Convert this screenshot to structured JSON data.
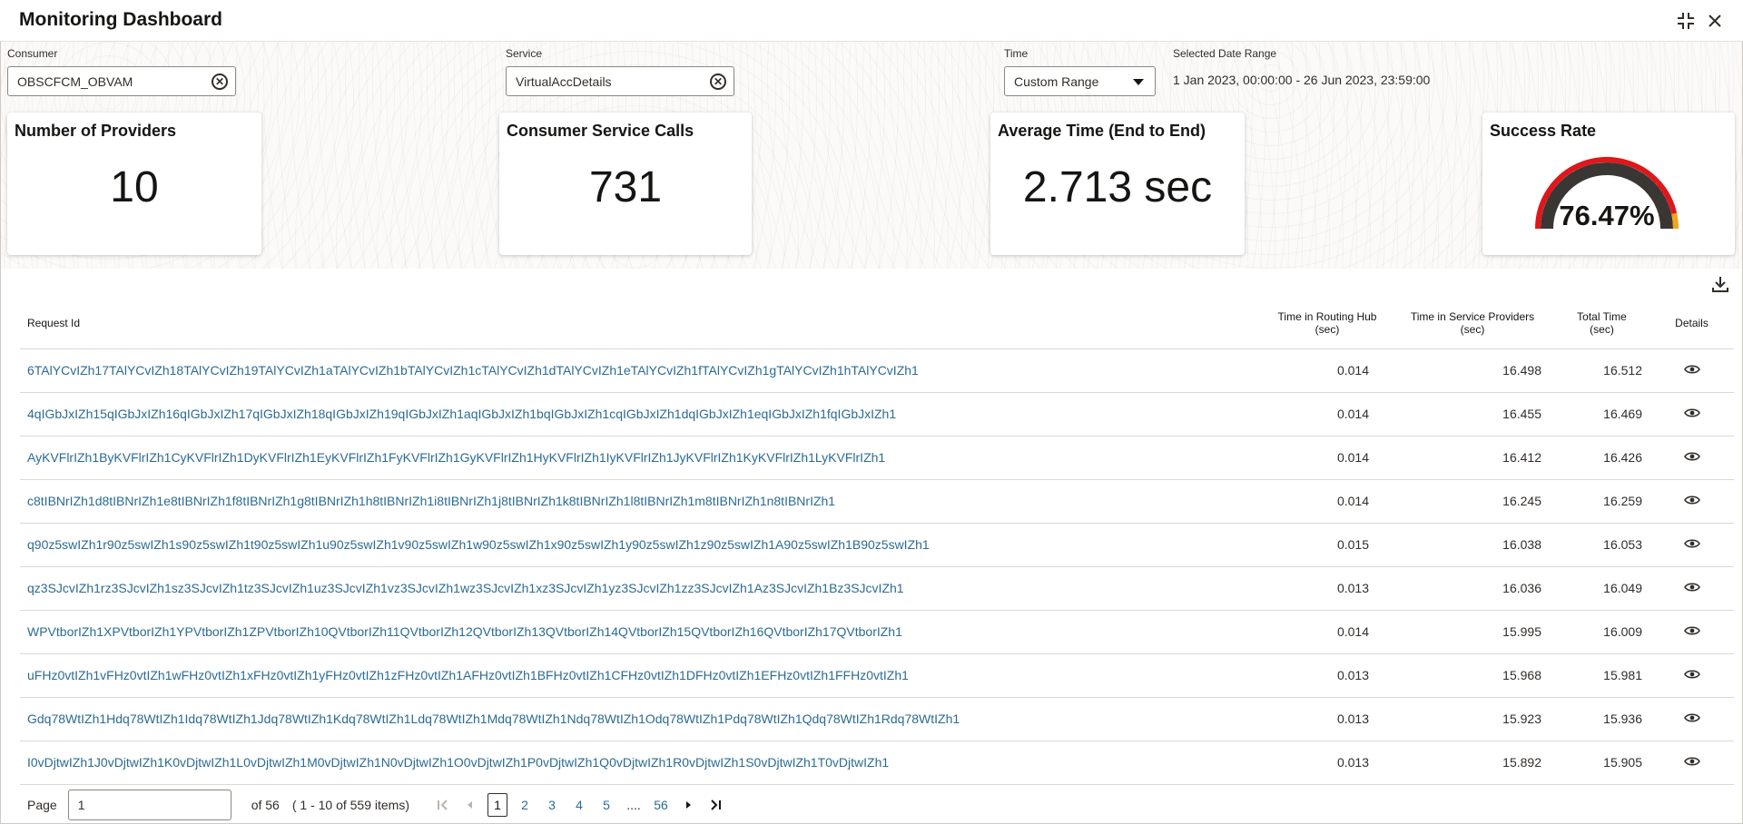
{
  "app": {
    "title": "Monitoring Dashboard"
  },
  "icons": {
    "collapse": "collapse-icon",
    "close": "close-icon",
    "clear": "clear-circle-icon",
    "download": "download-icon",
    "view": "eye-icon"
  },
  "filters": {
    "consumer_label": "Consumer",
    "consumer_value": "OBSCFCM_OBVAM",
    "service_label": "Service",
    "service_value": "VirtualAccDetails",
    "time_label": "Time",
    "time_value": "Custom Range",
    "date_range_label": "Selected Date Range",
    "date_range_value": "1 Jan 2023, 00:00:00 - 26 Jun 2023, 23:59:00"
  },
  "cards": {
    "providers_title": "Number of Providers",
    "providers_value": "10",
    "calls_title": "Consumer Service Calls",
    "calls_value": "731",
    "avg_title": "Average Time (End to End)",
    "avg_value": "2.713 sec",
    "success_title": "Success Rate",
    "success_value": "76.47%",
    "success_fraction": 0.7647
  },
  "colors": {
    "link": "#2b6b93",
    "gauge_track": "#3a3634",
    "gauge_red": "#e0161b",
    "gauge_amber": "#f2a516",
    "gauge_green": "#2e9e3b"
  },
  "table": {
    "headers": {
      "request_id": "Request Id",
      "routing_hub_1": "Time in Routing Hub",
      "routing_hub_2": "(sec)",
      "service_providers_1": "Time in Service Providers",
      "service_providers_2": "(sec)",
      "total_1": "Total Time",
      "total_2": "(sec)",
      "details": "Details"
    },
    "rows": [
      {
        "id": "6TAlYCvIZh17TAlYCvIZh18TAlYCvIZh19TAlYCvIZh1aTAlYCvIZh1bTAlYCvIZh1cTAlYCvIZh1dTAlYCvIZh1eTAlYCvIZh1fTAlYCvIZh1gTAlYCvIZh1hTAlYCvIZh1",
        "hub": "0.014",
        "providers": "16.498",
        "total": "16.512"
      },
      {
        "id": "4qIGbJxIZh15qIGbJxIZh16qIGbJxIZh17qIGbJxIZh18qIGbJxIZh19qIGbJxIZh1aqIGbJxIZh1bqIGbJxIZh1cqIGbJxIZh1dqIGbJxIZh1eqIGbJxIZh1fqIGbJxIZh1",
        "hub": "0.014",
        "providers": "16.455",
        "total": "16.469"
      },
      {
        "id": "AyKVFlrIZh1ByKVFlrIZh1CyKVFlrIZh1DyKVFlrIZh1EyKVFlrIZh1FyKVFlrIZh1GyKVFlrIZh1HyKVFlrIZh1IyKVFlrIZh1JyKVFlrIZh1KyKVFlrIZh1LyKVFlrIZh1",
        "hub": "0.014",
        "providers": "16.412",
        "total": "16.426"
      },
      {
        "id": "c8tIBNrIZh1d8tIBNrIZh1e8tIBNrIZh1f8tIBNrIZh1g8tIBNrIZh1h8tIBNrIZh1i8tIBNrIZh1j8tIBNrIZh1k8tIBNrIZh1l8tIBNrIZh1m8tIBNrIZh1n8tIBNrIZh1",
        "hub": "0.014",
        "providers": "16.245",
        "total": "16.259"
      },
      {
        "id": "q90z5swIZh1r90z5swIZh1s90z5swIZh1t90z5swIZh1u90z5swIZh1v90z5swIZh1w90z5swIZh1x90z5swIZh1y90z5swIZh1z90z5swIZh1A90z5swIZh1B90z5swIZh1",
        "hub": "0.015",
        "providers": "16.038",
        "total": "16.053"
      },
      {
        "id": "qz3SJcvIZh1rz3SJcvIZh1sz3SJcvIZh1tz3SJcvIZh1uz3SJcvIZh1vz3SJcvIZh1wz3SJcvIZh1xz3SJcvIZh1yz3SJcvIZh1zz3SJcvIZh1Az3SJcvIZh1Bz3SJcvIZh1",
        "hub": "0.013",
        "providers": "16.036",
        "total": "16.049"
      },
      {
        "id": "WPVtborIZh1XPVtborIZh1YPVtborIZh1ZPVtborIZh10QVtborIZh11QVtborIZh12QVtborIZh13QVtborIZh14QVtborIZh15QVtborIZh16QVtborIZh17QVtborIZh1",
        "hub": "0.014",
        "providers": "15.995",
        "total": "16.009"
      },
      {
        "id": "uFHz0vtIZh1vFHz0vtIZh1wFHz0vtIZh1xFHz0vtIZh1yFHz0vtIZh1zFHz0vtIZh1AFHz0vtIZh1BFHz0vtIZh1CFHz0vtIZh1DFHz0vtIZh1EFHz0vtIZh1FFHz0vtIZh1",
        "hub": "0.013",
        "providers": "15.968",
        "total": "15.981"
      },
      {
        "id": "Gdq78WtIZh1Hdq78WtIZh1Idq78WtIZh1Jdq78WtIZh1Kdq78WtIZh1Ldq78WtIZh1Mdq78WtIZh1Ndq78WtIZh1Odq78WtIZh1Pdq78WtIZh1Qdq78WtIZh1Rdq78WtIZh1",
        "hub": "0.013",
        "providers": "15.923",
        "total": "15.936"
      },
      {
        "id": "I0vDjtwIZh1J0vDjtwIZh1K0vDjtwIZh1L0vDjtwIZh1M0vDjtwIZh1N0vDjtwIZh1O0vDjtwIZh1P0vDjtwIZh1Q0vDjtwIZh1R0vDjtwIZh1S0vDjtwIZh1T0vDjtwIZh1",
        "hub": "0.013",
        "providers": "15.892",
        "total": "15.905"
      }
    ]
  },
  "pagination": {
    "page_label": "Page",
    "page_value": "1",
    "of_text": "of 56",
    "items_text": "( 1 - 10 of 559 items)",
    "pages": [
      "1",
      "2",
      "3",
      "4",
      "5",
      "....",
      "56"
    ],
    "current_page": "1"
  }
}
